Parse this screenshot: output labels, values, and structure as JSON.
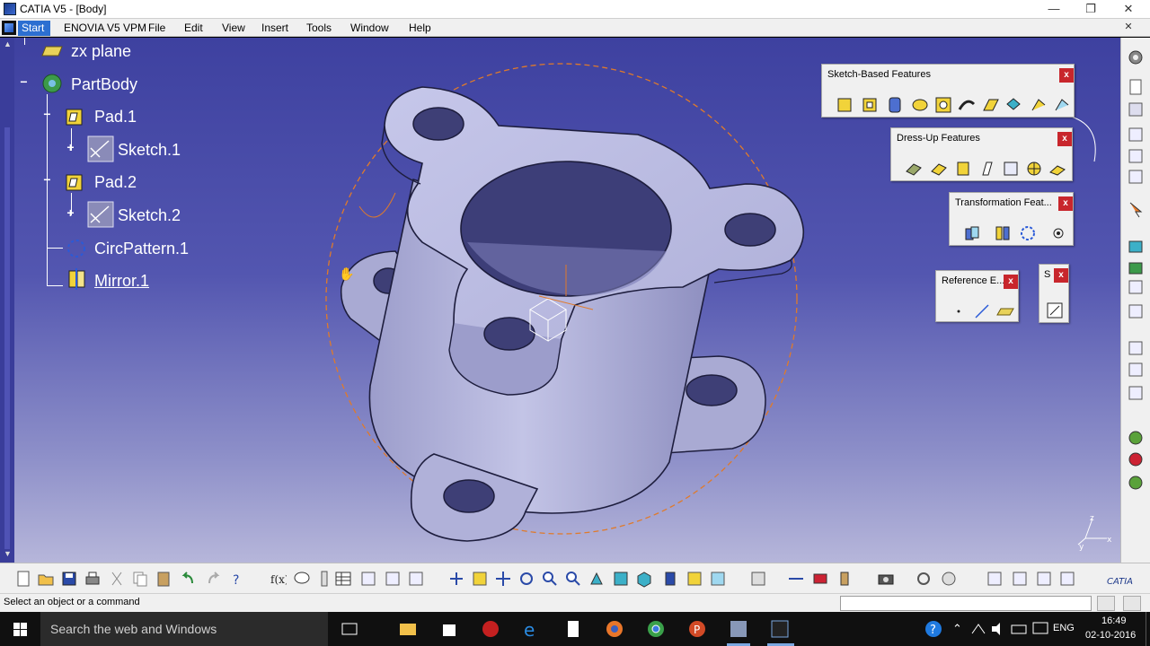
{
  "window": {
    "title": "CATIA V5 - [Body]",
    "minimize": "—",
    "restore": "❐",
    "close": "✕"
  },
  "menu": {
    "items": [
      "Start",
      "ENOVIA V5 VPM",
      "File",
      "Edit",
      "View",
      "Insert",
      "Tools",
      "Window",
      "Help"
    ]
  },
  "tree": {
    "items": [
      {
        "label": "zx plane"
      },
      {
        "label": "PartBody"
      },
      {
        "label": "Pad.1"
      },
      {
        "label": "Sketch.1"
      },
      {
        "label": "Pad.2"
      },
      {
        "label": "Sketch.2"
      },
      {
        "label": "CircPattern.1"
      },
      {
        "label": "Mirror.1"
      }
    ]
  },
  "toolbars": {
    "sketch_based": {
      "title": "Sketch-Based Features",
      "close": "x"
    },
    "dress_up": {
      "title": "Dress-Up Features",
      "close": "x"
    },
    "transformation": {
      "title": "Transformation Feat...",
      "close": "x"
    },
    "reference": {
      "title": "Reference E...",
      "close": "x"
    },
    "sketcher": {
      "title": "S",
      "close": "x"
    }
  },
  "status": {
    "prompt": "Select an object or a command",
    "command_value": ""
  },
  "taskbar": {
    "search_placeholder": "Search the web and Windows",
    "language": "ENG",
    "time": "16:49",
    "date": "02-10-2016"
  },
  "colors": {
    "viewport_top": "#3e41a0",
    "viewport_bottom": "#b6b6da",
    "part_fill": "#b4b5dd",
    "highlight_orange": "#e07a2a",
    "close_red": "#c8262c"
  },
  "icons": {
    "compass": "compass-icon",
    "axis": "xyz-axis-icon",
    "catia_logo": "catia-logo-icon"
  }
}
